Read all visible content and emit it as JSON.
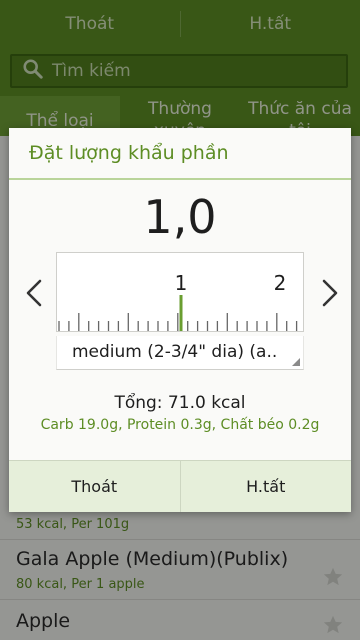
{
  "top_actions": {
    "cancel_label": "Thoát",
    "done_label": "H.tất"
  },
  "search": {
    "placeholder": "Tìm kiếm"
  },
  "category_tabs": [
    {
      "label": "Thể loại"
    },
    {
      "label": "Thường xuyên"
    },
    {
      "label": "Thức ăn của tôi"
    }
  ],
  "food_list": [
    {
      "name": "",
      "meta": "53 kcal, Per 101g"
    },
    {
      "name": "Gala Apple (Medium)(Publix)",
      "meta": "80 kcal, Per 1 apple"
    },
    {
      "name": "Apple",
      "meta": ""
    }
  ],
  "dialog": {
    "title": "Đặt lượng khẩu phần",
    "value": "1,0",
    "ruler_labels": [
      "1",
      "2"
    ],
    "unit": "medium (2-3/4\" dia) (a..",
    "total": "Tổng: 71.0 kcal",
    "macros": "Carb 19.0g, Protein 0.3g, Chất béo 0.2g",
    "cancel_label": "Thoát",
    "done_label": "H.tất"
  },
  "colors": {
    "brand_green": "#5d8d24",
    "accent_light": "#b9d49a"
  }
}
